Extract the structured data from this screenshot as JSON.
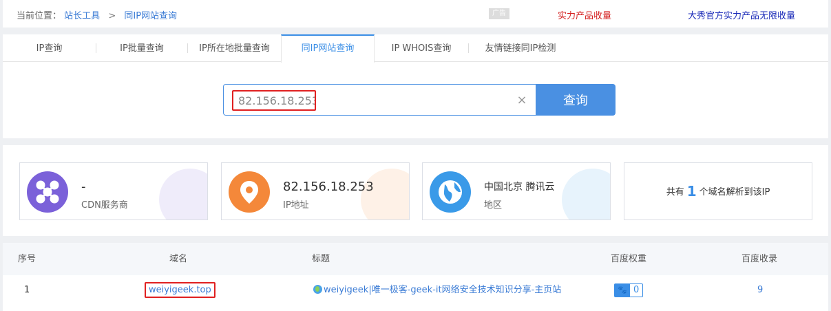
{
  "breadcrumb": {
    "prefix": "当前位置：",
    "item1": "站长工具",
    "separator": ">",
    "item2": "同IP网站查询"
  },
  "ads": {
    "badge": "广告",
    "link_red": "实力产品收量",
    "link_blue": "大秀官方实力产品无限收量"
  },
  "tabs": [
    {
      "label": "IP查询"
    },
    {
      "label": "IP批量查询"
    },
    {
      "label": "IP所在地批量查询"
    },
    {
      "label": "同IP网站查询",
      "active": true
    },
    {
      "label": "IP WHOIS查询"
    },
    {
      "label": "友情链接同IP检测"
    }
  ],
  "search": {
    "value": "82.156.18.253",
    "clear_icon": "×",
    "button_label": "查询"
  },
  "cards": {
    "cdn": {
      "value": "-",
      "label": "CDN服务商",
      "icon": "share-nodes-icon",
      "color": "#7b61d9"
    },
    "ip": {
      "value": "82.156.18.253",
      "label": "IP地址",
      "icon": "location-pin-icon",
      "color": "#f4883a"
    },
    "region": {
      "value": "中国北京 腾讯云",
      "label": "地区",
      "icon": "globe-icon",
      "color": "#3a9ae8"
    },
    "count": {
      "prefix": "共有",
      "number": "1",
      "suffix": "个域名解析到该IP"
    }
  },
  "table": {
    "headers": {
      "index": "序号",
      "domain": "域名",
      "title": "标题",
      "weight": "百度权重",
      "indexed": "百度收录"
    },
    "rows": [
      {
        "index": "1",
        "domain": "weiyigeek.top",
        "title": "weiyigeek|唯一极客-geek-it网络安全技术知识分享-主页站",
        "weight": "0",
        "indexed": "9"
      }
    ]
  }
}
